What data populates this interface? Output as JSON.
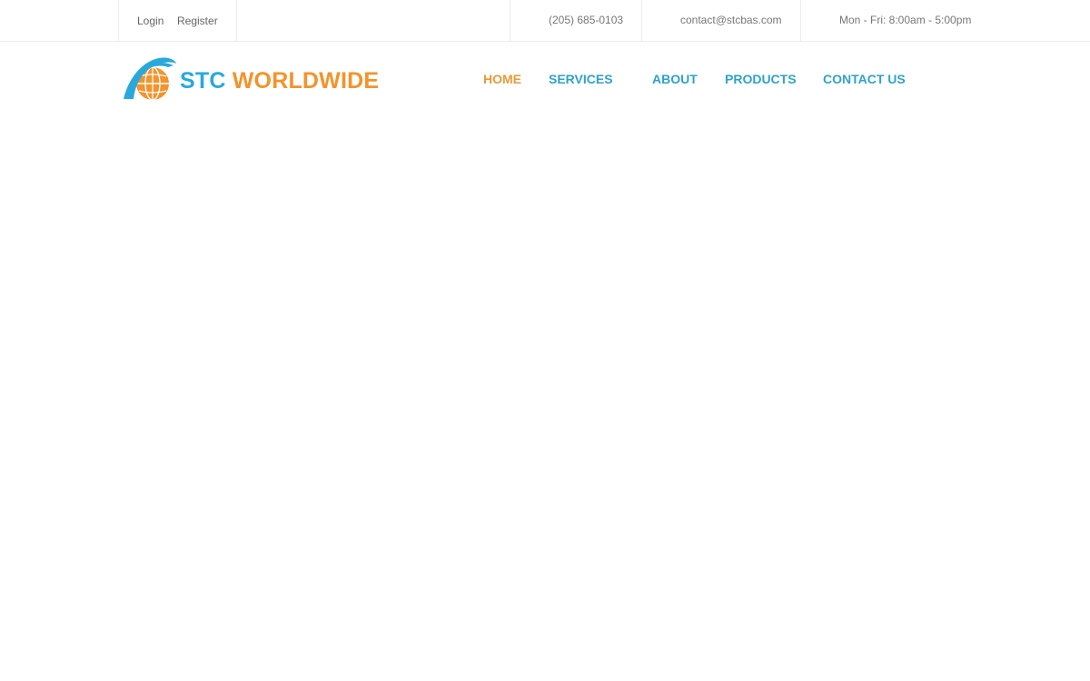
{
  "topbar": {
    "login_label": "Login",
    "register_label": "Register",
    "phone": "(205) 685-0103",
    "email": "contact@stcbas.com",
    "hours": "Mon - Fri: 8:00am - 5:00pm"
  },
  "brand": {
    "name_part1": "STC",
    "name_part2": "WORLDWIDE",
    "colors": {
      "blue": "#29a8dc",
      "orange": "#f4932b"
    },
    "logo_icon": "globe-swoosh-icon"
  },
  "nav": {
    "items": [
      {
        "label": "HOME",
        "active": true
      },
      {
        "label": "SERVICES",
        "active": false
      },
      {
        "label": "ABOUT",
        "active": false
      },
      {
        "label": "PRODUCTS",
        "active": false
      },
      {
        "label": "CONTACT US",
        "active": false
      }
    ],
    "active_color": "#e99a36",
    "link_color": "#2ea3c9"
  }
}
